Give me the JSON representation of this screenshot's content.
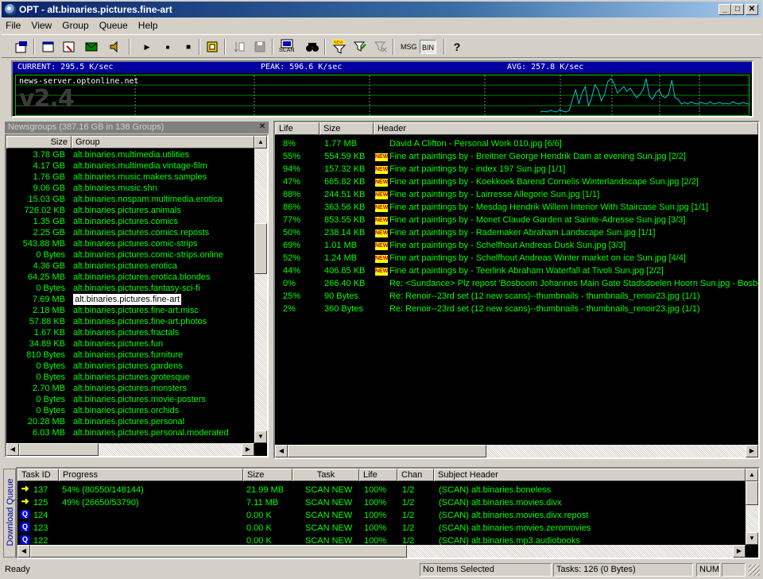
{
  "window": {
    "title": "OPT - alt.binaries.pictures.fine-art"
  },
  "menu": [
    "File",
    "View",
    "Group",
    "Queue",
    "Help"
  ],
  "toolbar": {
    "scan_label": "SCAN",
    "msg_label": "MSG",
    "bin_label": "BIN"
  },
  "speed": {
    "current": "CURRENT:  295.5 K/sec",
    "peak": "PEAK:  596.6 K/sec",
    "avg": "AVG:  257.8 K/sec",
    "server": "news-server.optonline.net",
    "version": "v2.4",
    "samples": [
      2,
      3,
      2,
      4,
      3,
      2,
      5,
      3,
      2,
      4,
      18,
      30,
      12,
      26,
      34,
      10,
      20,
      36,
      30,
      16,
      24,
      40,
      44,
      38,
      26,
      30,
      34,
      28,
      32,
      26,
      20,
      24,
      30,
      44,
      22,
      18,
      26,
      30,
      22,
      20,
      24,
      42,
      20,
      18,
      12,
      14,
      12,
      15,
      13,
      12,
      14,
      13,
      12,
      15,
      12,
      13,
      14,
      12,
      13,
      12,
      15,
      13,
      12,
      14,
      13,
      12
    ]
  },
  "newsgroups": {
    "caption": "Newsgroups (387.16 GB in 138 Groups)",
    "col_size": "Size",
    "col_group": "Group",
    "rows": [
      {
        "size": "3.78 GB",
        "group": "alt.binaries.multimedia.utilities"
      },
      {
        "size": "4.17 GB",
        "group": "alt.binaries.multimedia.vintage-film"
      },
      {
        "size": "1.76 GB",
        "group": "alt.binaries.music.makers.samples"
      },
      {
        "size": "9.06 GB",
        "group": "alt.binaries.music.shn"
      },
      {
        "size": "15.03 GB",
        "group": "alt.binaries.nospam.multimedia.erotica"
      },
      {
        "size": "726.02 KB",
        "group": "alt.binaries.pictures.animals"
      },
      {
        "size": "1.35 GB",
        "group": "alt.binaries.pictures.comics"
      },
      {
        "size": "2.25 GB",
        "group": "alt.binaries.pictures.comics.reposts"
      },
      {
        "size": "543.88 MB",
        "group": "alt.binaries.pictures.comic-strips"
      },
      {
        "size": "0 Bytes",
        "group": "alt.binaries.pictures.comic-strips.online"
      },
      {
        "size": "4.36 GB",
        "group": "alt.binaries.pictures.erotica"
      },
      {
        "size": "64.25 MB",
        "group": "alt.binaries.pictures.erotica.blondes"
      },
      {
        "size": "0 Bytes",
        "group": "alt.binaries.pictures.fantasy-sci-fi"
      },
      {
        "size": "7.69 MB",
        "group": "alt.binaries.pictures.fine-art",
        "selected": true
      },
      {
        "size": "2.18 MB",
        "group": "alt.binaries.pictures.fine-art.misc"
      },
      {
        "size": "57.88 KB",
        "group": "alt.binaries.pictures.fine-art.photos"
      },
      {
        "size": "1.67 KB",
        "group": "alt.binaries.pictures.fractals"
      },
      {
        "size": "34.89 KB",
        "group": "alt.binaries.pictures.fun"
      },
      {
        "size": "810 Bytes",
        "group": "alt.binaries.pictures.furniture"
      },
      {
        "size": "0 Bytes",
        "group": "alt.binaries.pictures.gardens"
      },
      {
        "size": "0 Bytes",
        "group": "alt.binaries.pictures.grotesque"
      },
      {
        "size": "2.70 MB",
        "group": "alt.binaries.pictures.monsters"
      },
      {
        "size": "0 Bytes",
        "group": "alt.binaries.pictures.movie-posters"
      },
      {
        "size": "0 Bytes",
        "group": "alt.binaries.pictures.orchids"
      },
      {
        "size": "20.28 MB",
        "group": "alt.binaries.pictures.personal"
      },
      {
        "size": "6.03 MB",
        "group": "alt.binaries.pictures.personal.moderated"
      }
    ]
  },
  "headers": {
    "col_life": "Life",
    "col_size": "Size",
    "col_header": "Header",
    "new_badge": "NEW",
    "rows": [
      {
        "life": "8%",
        "size": "1.77 MB",
        "new": false,
        "header": "David A Clifton - Personal Work 010.jpg [6/6]"
      },
      {
        "life": "55%",
        "size": "554.59 KB",
        "new": true,
        "header": "Fine art paintings by - Breitner George Hendrik Dam at evening Sun.jpg [2/2]"
      },
      {
        "life": "94%",
        "size": "157.32 KB",
        "new": true,
        "header": "Fine art paintings by - index 197 Sun.jpg [1/1]"
      },
      {
        "life": "47%",
        "size": "665.82 KB",
        "new": true,
        "header": "Fine art paintings by - Koekkoek Barend Cornelis Winterlandscape Sun.jpg [2/2]"
      },
      {
        "life": "88%",
        "size": "244.51 KB",
        "new": true,
        "header": "Fine art paintings by - Lairresse Allegorie Sun.jpg [1/1]"
      },
      {
        "life": "86%",
        "size": "363.56 KB",
        "new": true,
        "header": "Fine art paintings by - Mesdag Hendrik Willem Interior With Staircase Sun.jpg [1/1]"
      },
      {
        "life": "77%",
        "size": "853.55 KB",
        "new": true,
        "header": "Fine art paintings by - Monet Claude Garden at Sainte-Adresse Sun.jpg [3/3]"
      },
      {
        "life": "50%",
        "size": "238.14 KB",
        "new": true,
        "header": "Fine art paintings by - Rademaker Abraham Landscape Sun.jpg [1/1]"
      },
      {
        "life": "69%",
        "size": "1.01 MB",
        "new": true,
        "header": "Fine art paintings by - Schelfhout Andreas Dusk Sun.jpg [3/3]"
      },
      {
        "life": "52%",
        "size": "1.24 MB",
        "new": true,
        "header": "Fine art paintings by - Schelfhout Andreas Winter market on ice Sun.jpg [4/4]"
      },
      {
        "life": "44%",
        "size": "406.85 KB",
        "new": true,
        "header": "Fine art paintings by - Teerlink Abraham Waterfall at Tivoli Sun.jpg [2/2]"
      },
      {
        "life": "0%",
        "size": "266.40 KB",
        "new": false,
        "header": "Re: <Sundance> Plz repost 'Bosboom Johannes Main Gate Stadsdoelen Hoorn Sun.jpg - Bosboom"
      },
      {
        "life": "25%",
        "size": "90 Bytes",
        "new": false,
        "header": "Re: Renoir--23rd set (12 new scans)--thumbnails - thumbnails_renoir23.jpg (1/1)"
      },
      {
        "life": "2%",
        "size": "360 Bytes",
        "new": false,
        "header": "Re: Renoir--23rd set (12 new scans)--thumbnails - thumbnails_renoir23.jpg (1/1)"
      }
    ]
  },
  "queue": {
    "tab_label": "Download Queue",
    "cols": [
      "Task ID",
      "Progress",
      "Size",
      "Task",
      "Life",
      "Chan",
      "Subject Header"
    ],
    "rows": [
      {
        "icon": "arrow",
        "id": "137",
        "progress": "54% (80550/148144)",
        "size": "21.99 MB",
        "task": "SCAN NEW",
        "life": "100%",
        "chan": "1/2",
        "subject": "(SCAN) alt.binaries.boneless"
      },
      {
        "icon": "arrow",
        "id": "125",
        "progress": "49% (26650/53790)",
        "size": "7.11 MB",
        "task": "SCAN NEW",
        "life": "100%",
        "chan": "1/2",
        "subject": "(SCAN) alt.binaries.movies.divx"
      },
      {
        "icon": "q",
        "id": "124",
        "progress": "",
        "size": "0.00 K",
        "task": "SCAN NEW",
        "life": "100%",
        "chan": "1/2",
        "subject": "(SCAN) alt.binaries.movies.divx.repost"
      },
      {
        "icon": "q",
        "id": "123",
        "progress": "",
        "size": "0.00 K",
        "task": "SCAN NEW",
        "life": "100%",
        "chan": "1/2",
        "subject": "(SCAN) alt.binaries.movies.zeromovies"
      },
      {
        "icon": "q",
        "id": "122",
        "progress": "",
        "size": "0.00 K",
        "task": "SCAN NEW",
        "life": "100%",
        "chan": "1/2",
        "subject": "(SCAN) alt.binaries.mp3.audiobooks"
      }
    ],
    "q_glyph": "Q",
    "arrow_glyph": "➜"
  },
  "status": {
    "ready": "Ready",
    "selection": "No Items Selected",
    "tasks": "Tasks: 126 (0 Bytes)",
    "num": "NUM"
  },
  "colors": {
    "list_bg": "#000000",
    "list_text": "#00ff00",
    "speed_header": "#0000a0",
    "title_start": "#0a246a"
  }
}
